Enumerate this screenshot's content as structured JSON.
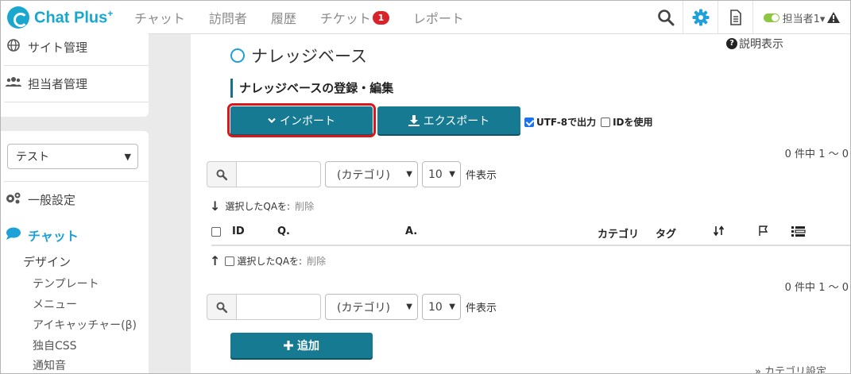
{
  "app": {
    "name": "Chat Plus",
    "name_sup": "+"
  },
  "header": {
    "nav": [
      {
        "label": "チャット"
      },
      {
        "label": "訪問者"
      },
      {
        "label": "履歴"
      },
      {
        "label": "チケット",
        "badge": "1"
      },
      {
        "label": "レポート"
      }
    ],
    "user": "担当者1▾"
  },
  "sidebar": {
    "top_items": [
      {
        "label": "サイト管理",
        "icon": "globe-icon"
      },
      {
        "label": "担当者管理",
        "icon": "users-icon"
      }
    ],
    "site_select": "テスト",
    "general_settings": "一般設定",
    "chat_section": "チャット",
    "design": "デザイン",
    "design_items": [
      "テンプレート",
      "メニュー",
      "アイキャッチャー(β)",
      "独自CSS",
      "通知音"
    ]
  },
  "main": {
    "title": "ナレッジベース",
    "help": "説明表示",
    "section_title": "ナレッジベースの登録・編集",
    "import_label": "インポート",
    "export_label": "エクスポート",
    "utf8_label": "UTF-8で出力",
    "utf8_checked": true,
    "id_label": "IDを使用",
    "id_checked": false,
    "count_text": "0 件中 1 〜 0",
    "search_placeholder": "",
    "category_select": "(カテゴリ)",
    "per_page_select": "10",
    "per_page_label": "件表示",
    "bulk_label": "選択したQAを:",
    "bulk_delete": "削除",
    "columns": {
      "id": "ID",
      "q": "Q.",
      "a": "A.",
      "category": "カテゴリ",
      "tag": "タグ"
    },
    "add_label": "追加",
    "category_settings": "» カテゴリ設定"
  }
}
